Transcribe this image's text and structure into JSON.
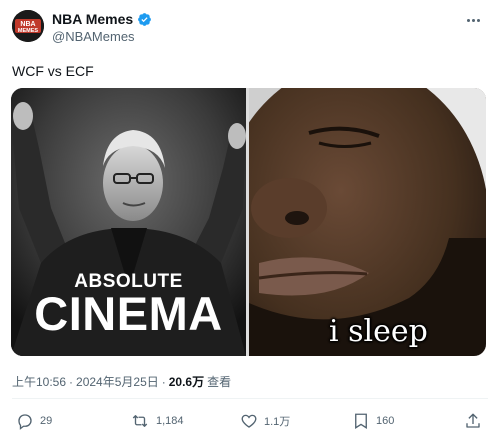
{
  "author": {
    "name": "NBA Memes",
    "handle": "@NBAMemes",
    "verified": true,
    "avatar_text_top": "NBA",
    "avatar_text_bottom": "MEMES"
  },
  "tweet": {
    "text": "WCF vs ECF"
  },
  "media": {
    "left": {
      "caption_small": "ABSOLUTE",
      "caption_big": "CINEMA"
    },
    "right": {
      "caption": "i sleep"
    }
  },
  "meta": {
    "time": "上午10:56",
    "separator": "·",
    "date": "2024年5月25日",
    "separator2": "·",
    "views": "20.6万",
    "views_label": "查看"
  },
  "actions": {
    "replies": "29",
    "retweets": "1,184",
    "likes": "1.1万",
    "bookmarks": "160"
  },
  "colors": {
    "verified": "#1d9bf0",
    "secondary_text": "#536471",
    "primary_text": "#0f1419"
  },
  "icons": {
    "more": "more-icon",
    "reply": "reply-icon",
    "retweet": "retweet-icon",
    "like": "heart-icon",
    "bookmark": "bookmark-icon",
    "share": "share-icon",
    "verified": "verified-badge-icon"
  }
}
